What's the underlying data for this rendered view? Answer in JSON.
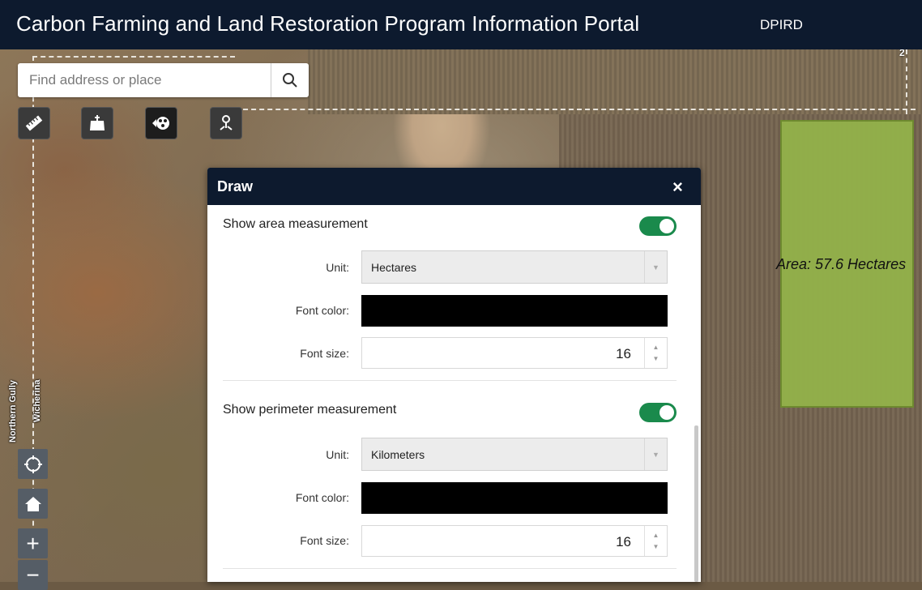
{
  "header": {
    "title": "Carbon Farming and Land Restoration Program Information Portal",
    "org": "DPIRD"
  },
  "search": {
    "placeholder": "Find address or place"
  },
  "tools": [
    "measure-icon",
    "add-data-icon",
    "draw-icon",
    "location-pin-icon"
  ],
  "map": {
    "area_label": "Area: 57.6 Hectares",
    "road_labels": [
      "Northern Gully",
      "Wicherina"
    ],
    "corner_label": "2"
  },
  "nav": {
    "locate_icon": "locate-icon",
    "home_icon": "home-icon",
    "zoom_in": "+",
    "zoom_out": "−"
  },
  "draw_panel": {
    "title": "Draw",
    "close": "×",
    "area": {
      "label": "Show area measurement",
      "enabled": true,
      "unit_label": "Unit:",
      "unit_value": "Hectares",
      "font_color_label": "Font color:",
      "font_color": "#000000",
      "font_size_label": "Font size:",
      "font_size": "16"
    },
    "perimeter": {
      "label": "Show perimeter measurement",
      "enabled": true,
      "unit_label": "Unit:",
      "unit_value": "Kilometers",
      "font_color_label": "Font color:",
      "font_color": "#000000",
      "font_size_label": "Font size:",
      "font_size": "16"
    }
  },
  "colors": {
    "header_bg": "#0d1a2e",
    "toggle_on": "#1a8a4c",
    "polygon_fill": "#93b24a"
  }
}
